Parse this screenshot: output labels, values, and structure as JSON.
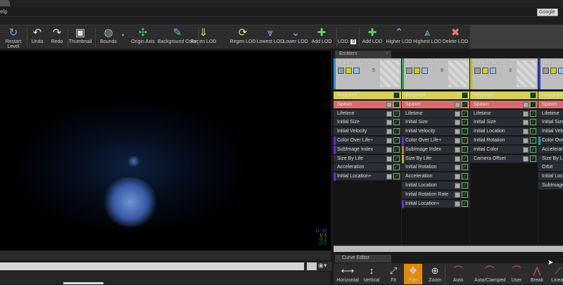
{
  "menu": {
    "help_partial": "elp",
    "search_engine": "Google ▾"
  },
  "toolbar": [
    {
      "label": "Restart Level",
      "icon": "restart-icon",
      "glyph": "↻",
      "color": "#7fa6e0"
    },
    {
      "label": "Undo",
      "icon": "undo-icon",
      "glyph": "↶",
      "color": "#ddd"
    },
    {
      "label": "Redo",
      "icon": "redo-icon",
      "glyph": "↷",
      "color": "#ddd"
    },
    {
      "label": "Thumbnail",
      "icon": "thumbnail-icon",
      "glyph": "▣",
      "color": "#ddd"
    },
    {
      "label": "Bounds",
      "icon": "bounds-icon",
      "glyph": "◍",
      "color": "#9bb"
    },
    {
      "label": "Origin Axis",
      "icon": "origin-axis-icon",
      "glyph": "✣",
      "color": "#4b6"
    },
    {
      "label": "Background Color",
      "icon": "background-color-icon",
      "glyph": "✎",
      "color": "#6bd"
    },
    {
      "label": "Regen LOD",
      "icon": "regen-lod-icon",
      "glyph": "⇓",
      "color": "#dd8"
    },
    {
      "label": "Regen LOD",
      "icon": "regen-lod-alt-icon",
      "glyph": "⟳",
      "color": "#dd8"
    },
    {
      "label": "Lowest LOD",
      "icon": "lowest-lod-icon",
      "glyph": "⩔",
      "color": "#8ad"
    },
    {
      "label": "Lower LOD",
      "icon": "lower-lod-icon",
      "glyph": "⌄",
      "color": "#8ad"
    },
    {
      "label": "Add LOD",
      "icon": "add-lod-icon",
      "glyph": "✚",
      "color": "#6c6"
    },
    {
      "label": "Add LOD",
      "icon": "add-lod-up-icon",
      "glyph": "✚",
      "color": "#6c6"
    },
    {
      "label": "Higher LOD",
      "icon": "higher-lod-icon",
      "glyph": "⌃",
      "color": "#8ad"
    },
    {
      "label": "Highest LOD",
      "icon": "highest-lod-icon",
      "glyph": "⩓",
      "color": "#8ad"
    },
    {
      "label": "Delete LOD",
      "icon": "delete-lod-icon",
      "glyph": "✖",
      "color": "#e77"
    }
  ],
  "lod": {
    "label": "LOD:",
    "value": "0"
  },
  "viewport": {
    "stats": [
      "11/ 35",
      "1/ 3",
      "0/ 1",
      "0/ 5"
    ]
  },
  "emitters_tab": "Emitters",
  "curve_editor_tab": "Curve Editor",
  "emitters": [
    {
      "name": "Trans_Velocity",
      "count": "5",
      "color": "#2a8fd0",
      "modules": [
        "Required",
        "Spawn",
        "Lifetime",
        "Initial Size",
        "Initial Velocity",
        "Color Over Life+",
        "SubImage Index",
        "Size By Life",
        "Acceleration",
        "Initial Location+"
      ],
      "stripes": {
        "5": "#6a2bd0",
        "6": "#6a2bd0",
        "9": "#6a2bd0"
      }
    },
    {
      "name": "Trans_Square",
      "count": "9",
      "color": "#2aa04a",
      "modules": [
        "Required",
        "Spawn",
        "Lifetime",
        "Initial Size",
        "Initial Velocity",
        "Color Over Life+",
        "SubImage Index",
        "Size By Life",
        "Initial Rotation",
        "Acceleration",
        "Initial Location",
        "Initial Rotation Rate",
        "Initial Location+"
      ],
      "stripes": {
        "5": "#6a2bd0",
        "6": "#c07a20",
        "7": "#c0b020",
        "12": "#6a2bd0"
      }
    },
    {
      "name": "Particle Emitter",
      "count": "3",
      "color": "#b0c020",
      "modules": [
        "Required",
        "Spawn",
        "Lifetime",
        "Initial Size",
        "Initial Location",
        "Initial Rotation",
        "Initial Color",
        "Camera Offset"
      ],
      "stripes": {}
    },
    {
      "name": "sparks",
      "count": "",
      "color": "#2a40c0",
      "modules": [
        "Required",
        "Spawn",
        "Lifetime",
        "Initial Size",
        "Initial Velo",
        "Color Over",
        "Accelerat",
        "Size By Li",
        "Orbit",
        "Initial Loc",
        "SubImage"
      ],
      "stripes": {
        "5": "#20a0a0"
      }
    }
  ],
  "curve_toolbar": [
    {
      "label": "Horizontal",
      "icon": "fit-horizontal-icon",
      "glyph": "⟷"
    },
    {
      "label": "Vertical",
      "icon": "fit-vertical-icon",
      "glyph": "↕"
    },
    {
      "label": "Fit",
      "icon": "fit-icon",
      "glyph": "⤢"
    },
    {
      "label": "Pan",
      "icon": "pan-icon",
      "glyph": "✥",
      "active": true
    },
    {
      "label": "Zoom",
      "icon": "zoom-icon",
      "glyph": "⊕"
    },
    {
      "label": "Auto",
      "icon": "auto-tangent-icon",
      "glyph": "⌒"
    },
    {
      "label": "Auto/Clamped",
      "icon": "auto-clamped-tangent-icon",
      "glyph": "⌒"
    },
    {
      "label": "User",
      "icon": "user-tangent-icon",
      "glyph": "⌒"
    },
    {
      "label": "Break",
      "icon": "break-tangent-icon",
      "glyph": "⋀"
    },
    {
      "label": "Linear",
      "icon": "linear-tangent-icon",
      "glyph": "⟋"
    }
  ],
  "colors": {
    "required": "#d6cf5a",
    "spawn": "#d86c6c",
    "accent_pan": "#e08a10"
  }
}
